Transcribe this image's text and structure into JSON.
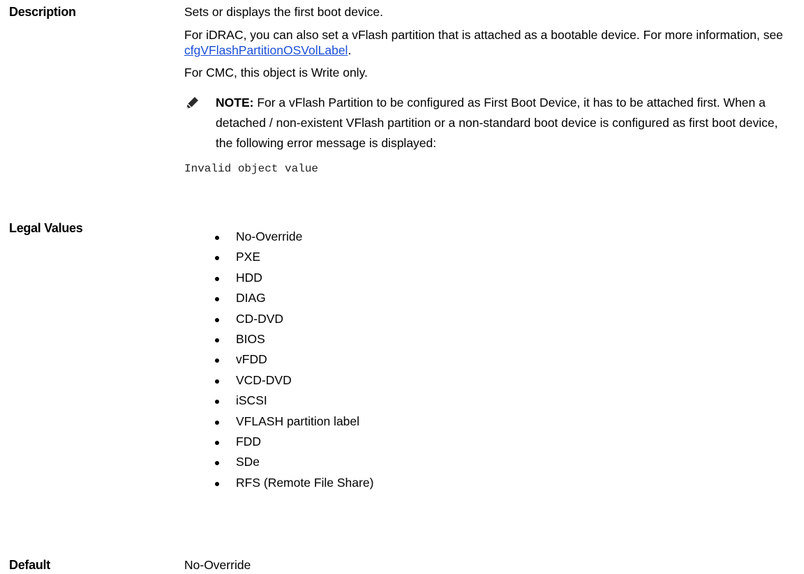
{
  "rows": {
    "description": {
      "label": "Description",
      "line1": "Sets or displays the first boot device.",
      "line2_before": "For iDRAC, you can also set a vFlash partition that is attached as a bootable device. For more information, see ",
      "line2_link": "cfgVFlashPartitionOSVolLabel",
      "line2_after": ".",
      "line3": "For CMC, this object is Write only.",
      "note_prefix": "NOTE:",
      "note_text": " For a vFlash Partition to be configured as First Boot Device, it has to be attached first. When a detached / non-existent VFlash partition or a non-standard boot device is configured as first boot device, the following error message is displayed:",
      "error_code": "Invalid object value"
    },
    "legal_values": {
      "label": "Legal Values",
      "items": [
        "No-Override",
        "PXE",
        "HDD",
        "DIAG",
        "CD-DVD",
        "BIOS",
        "vFDD",
        "VCD-DVD",
        "iSCSI",
        "VFLASH partition label",
        "FDD",
        "SDe",
        "RFS (Remote File Share)"
      ]
    },
    "default": {
      "label": "Default",
      "value": "No-Override"
    }
  },
  "icons": {
    "note": "pencil-note-icon"
  },
  "colors": {
    "link": "#1a4fd6"
  }
}
